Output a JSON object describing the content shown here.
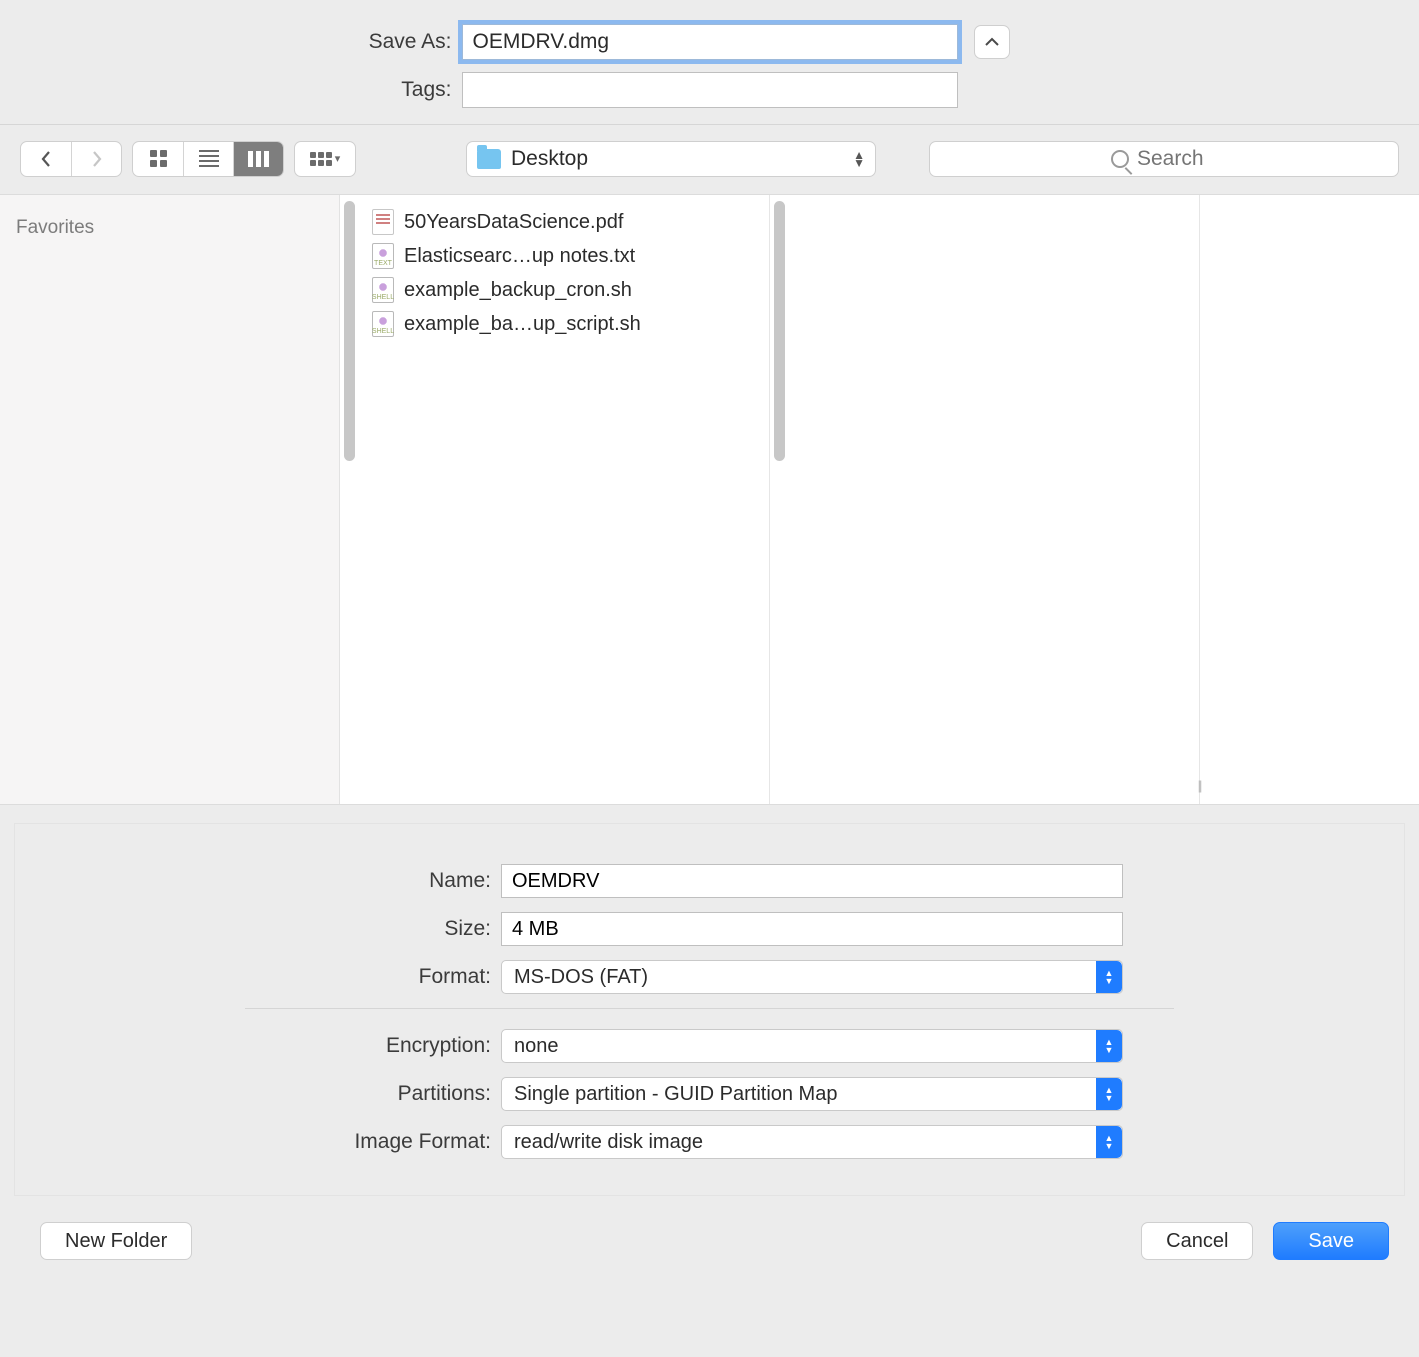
{
  "header": {
    "save_as_label": "Save As:",
    "save_as_value": "OEMDRV.dmg",
    "tags_label": "Tags:",
    "tags_value": ""
  },
  "toolbar": {
    "location": "Desktop",
    "search_placeholder": "Search"
  },
  "sidebar": {
    "section_title": "Favorites"
  },
  "files": [
    {
      "name": "50YearsDataScience.pdf",
      "kind": "pdf"
    },
    {
      "name": "Elasticsearc…up notes.txt",
      "kind": "txt"
    },
    {
      "name": "example_backup_cron.sh",
      "kind": "sh"
    },
    {
      "name": "example_ba…up_script.sh",
      "kind": "sh"
    }
  ],
  "options": {
    "name_label": "Name:",
    "name_value": "OEMDRV",
    "size_label": "Size:",
    "size_value": "4 MB",
    "format_label": "Format:",
    "format_value": "MS-DOS (FAT)",
    "encryption_label": "Encryption:",
    "encryption_value": "none",
    "partitions_label": "Partitions:",
    "partitions_value": "Single partition - GUID Partition Map",
    "image_format_label": "Image Format:",
    "image_format_value": "read/write disk image"
  },
  "buttons": {
    "new_folder": "New Folder",
    "cancel": "Cancel",
    "save": "Save"
  }
}
